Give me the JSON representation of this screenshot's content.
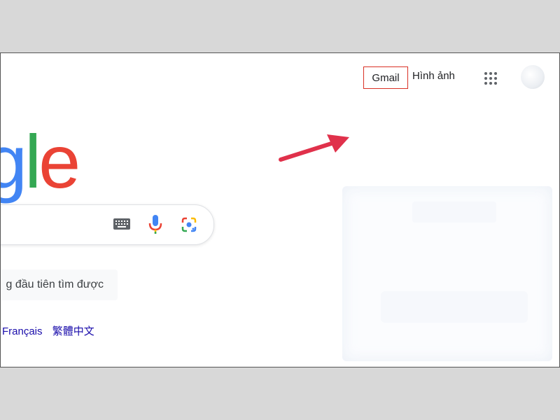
{
  "header": {
    "gmail_label": "Gmail",
    "images_label": "Hình ảnh",
    "apps_icon": "apps-grid-icon",
    "avatar_icon": "account-avatar"
  },
  "logo": {
    "letters": [
      "g",
      "l",
      "e"
    ],
    "colors": [
      "#4285f4",
      "#34a853",
      "#ea4335"
    ]
  },
  "search": {
    "keyboard_icon": "keyboard-icon",
    "mic_icon": "microphone-icon",
    "lens_icon": "google-lens-icon"
  },
  "buttons": {
    "lucky_label": "g đầu tiên tìm được"
  },
  "languages": [
    "Français",
    "繁體中文"
  ],
  "annotation": {
    "arrow_color": "#e0314b",
    "highlight_color": "#d93025"
  }
}
